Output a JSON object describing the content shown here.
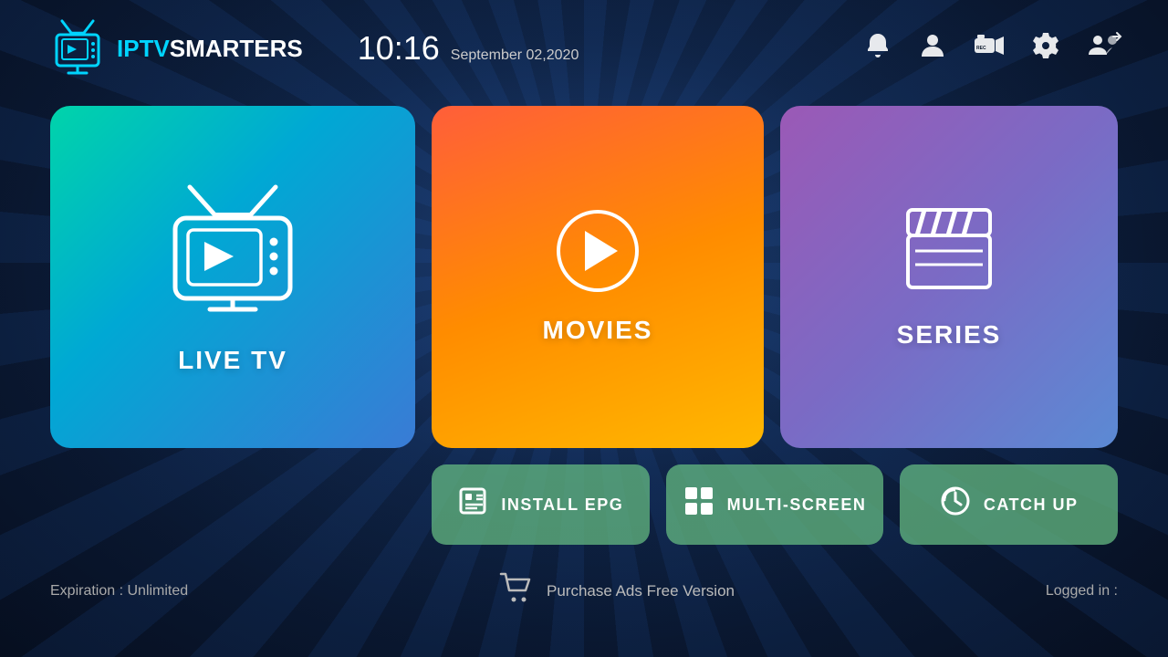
{
  "header": {
    "logo_iptv": "IPTV",
    "logo_smarters": "SMARTERS",
    "time": "10:16",
    "date": "September 02,2020"
  },
  "icons": {
    "bell": "🔔",
    "user": "👤",
    "record": "⏺",
    "settings": "⚙",
    "switch_user": "👥"
  },
  "cards": {
    "live_tv": "LIVE TV",
    "movies": "MOVIES",
    "series": "SERIES",
    "install_epg": "INSTALL EPG",
    "multi_screen": "MULTI-SCREEN",
    "catch_up": "CATCH UP"
  },
  "footer": {
    "expiration": "Expiration : Unlimited",
    "purchase": "Purchase Ads Free Version",
    "logged_in": "Logged in :"
  }
}
